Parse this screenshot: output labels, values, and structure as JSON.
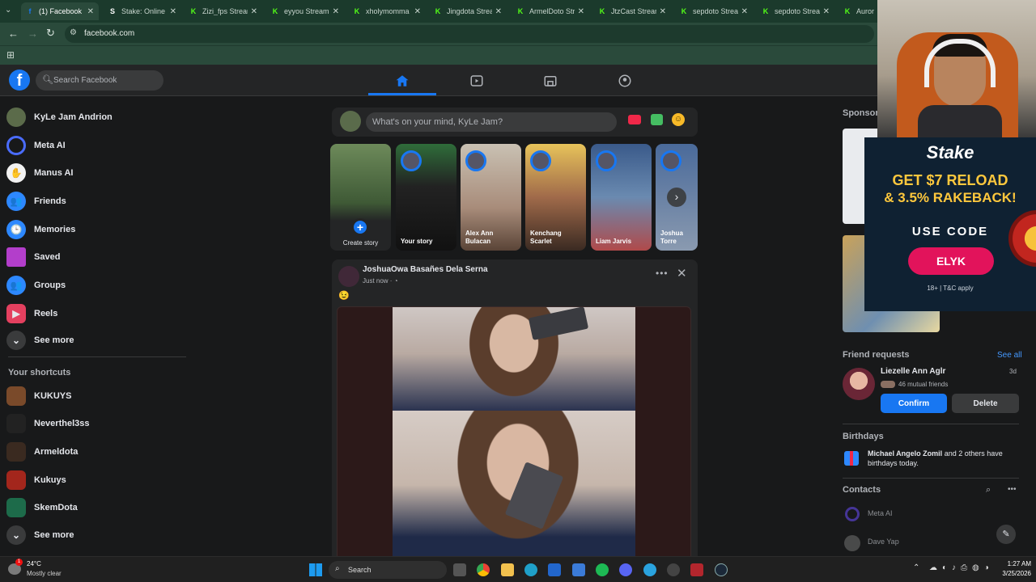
{
  "browser": {
    "tabs": [
      {
        "title": "(1) Facebook",
        "fav": "f",
        "color": "#1877f2"
      },
      {
        "title": "Stake: Online C",
        "fav": "S",
        "color": "#ffffff"
      },
      {
        "title": "Zizi_fps Stream",
        "fav": "K",
        "color": "#53fc18"
      },
      {
        "title": "eyyou Stream",
        "fav": "K",
        "color": "#53fc18"
      },
      {
        "title": "xholymomma",
        "fav": "K",
        "color": "#53fc18"
      },
      {
        "title": "Jingdota Strea",
        "fav": "K",
        "color": "#53fc18"
      },
      {
        "title": "ArmelDoto Str",
        "fav": "K",
        "color": "#53fc18"
      },
      {
        "title": "JtzCast Stream",
        "fav": "K",
        "color": "#53fc18"
      },
      {
        "title": "sepdoto Strea",
        "fav": "K",
        "color": "#53fc18"
      },
      {
        "title": "sepdoto Strea",
        "fav": "K",
        "color": "#53fc18"
      },
      {
        "title": "Aurora",
        "fav": "K",
        "color": "#53fc18"
      }
    ],
    "url": "facebook.com"
  },
  "header": {
    "search_placeholder": "Search Facebook"
  },
  "sidebar": {
    "items": [
      {
        "label": "KyLe Jam Andrion",
        "icon": "avatar"
      },
      {
        "label": "Meta AI",
        "icon": "meta-ai-icon"
      },
      {
        "label": "Manus AI",
        "icon": "manus-icon"
      },
      {
        "label": "Friends",
        "icon": "friends-icon"
      },
      {
        "label": "Memories",
        "icon": "clock-icon"
      },
      {
        "label": "Saved",
        "icon": "bookmark-icon"
      },
      {
        "label": "Groups",
        "icon": "groups-icon"
      },
      {
        "label": "Reels",
        "icon": "reels-icon"
      },
      {
        "label": "See more",
        "icon": "chevron-down-icon"
      }
    ],
    "shortcuts_title": "Your shortcuts",
    "shortcuts": [
      {
        "label": "KUKUYS"
      },
      {
        "label": "Neverthel3ss"
      },
      {
        "label": "Armeldota"
      },
      {
        "label": "Kukuys"
      },
      {
        "label": "SkemDota"
      },
      {
        "label": "See more"
      }
    ]
  },
  "composer": {
    "placeholder": "What's on your mind, KyLe Jam?"
  },
  "stories": [
    {
      "name": "Create story"
    },
    {
      "name": "Your story"
    },
    {
      "name": "Alex Ann Bulacan"
    },
    {
      "name": "Kenchang Scarlet"
    },
    {
      "name": "Liam Jarvis"
    },
    {
      "name": "Joshua Torre"
    }
  ],
  "post": {
    "author": "JoshuaOwa Basañes Dela Serna",
    "time": "Just now · ",
    "body": "😉"
  },
  "right": {
    "sponsored_label": "Sponsore",
    "ad": {
      "brand": "Stake",
      "line1": "GET $7 RELOAD",
      "line2": "& 3.5% RAKEBACK!",
      "code_label": "USE CODE",
      "code": "ELYK",
      "disclaimer": "18+ | T&C apply"
    },
    "friend_requests": {
      "title": "Friend requests",
      "see_all": "See all",
      "name": "Liezelle Ann Aglr",
      "age": "3d",
      "mutual": "46 mutual friends",
      "confirm": "Confirm",
      "delete": "Delete"
    },
    "birthdays": {
      "title": "Birthdays",
      "name": "Michael Angelo Zomil",
      "rest": " and 2 others have birthdays today."
    },
    "contacts": {
      "title": "Contacts",
      "items": [
        {
          "name": "Meta AI"
        },
        {
          "name": "Dave Yap"
        }
      ]
    }
  },
  "taskbar": {
    "temp": "24°C",
    "weather": "Mostly clear",
    "search": "Search",
    "time": "1:27 AM",
    "date": "3/25/2026"
  },
  "colors": {
    "fb_blue": "#1877f2",
    "chrome_green": "#2a4a3b",
    "stake_navy": "#0f2132"
  }
}
